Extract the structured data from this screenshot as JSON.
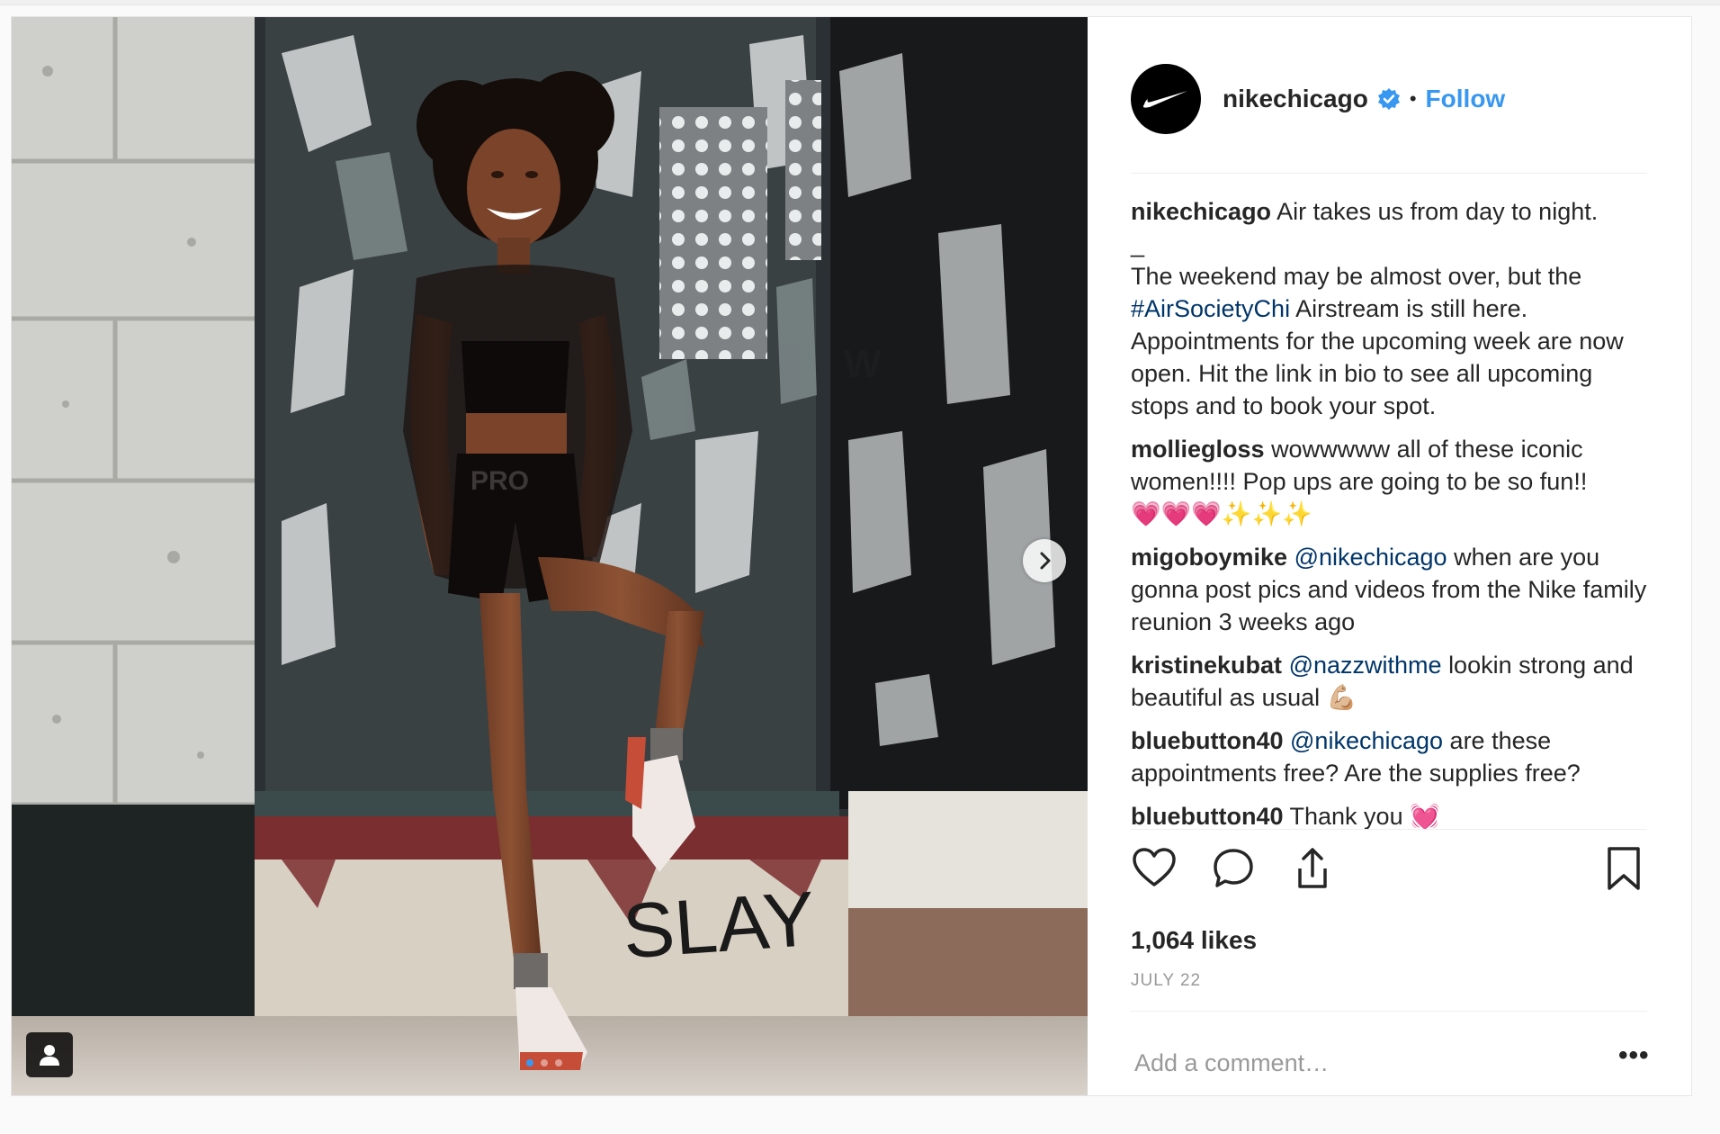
{
  "post": {
    "author": "nikechicago",
    "verified": true,
    "separator": "•",
    "follow_label": "Follow",
    "caption": {
      "user": "nikechicago",
      "line1": "Air takes us from day to night.",
      "dash": "_",
      "part1": "The weekend may be almost over, but the",
      "hashtag": "#AirSocietyChi",
      "part2": "Airstream is still here. Appointments for the upcoming week are now open. Hit the link in bio to see all upcoming stops and to book your spot."
    },
    "comments": [
      {
        "user": "molliegloss",
        "mention": "",
        "text": "wowwwww all of these iconic women!!!! Pop ups are going to be so fun!!",
        "emoji": "💗💗💗✨✨✨"
      },
      {
        "user": "migoboymike",
        "mention": "@nikechicago",
        "text": "when are you gonna post pics and videos from the Nike family reunion 3 weeks ago",
        "emoji": ""
      },
      {
        "user": "kristinekubat",
        "mention": "@nazzwithme",
        "text": "lookin strong and beautiful as usual",
        "emoji": "💪🏼"
      },
      {
        "user": "bluebutton40",
        "mention": "@nikechicago",
        "text": "are these appointments free? Are the supplies free?",
        "emoji": ""
      },
      {
        "user": "bluebutton40",
        "mention": "",
        "text": "Thank you",
        "emoji": "💓"
      }
    ],
    "likes": "1,064 likes",
    "date": "JULY 22",
    "comment_placeholder": "Add a comment…",
    "more_label": "•••",
    "photo": {
      "wall_graffiti": "SLAY",
      "shorts_text": "PRO"
    },
    "colors": {
      "link": "#003569",
      "follow": "#3897f0",
      "muted": "#999999"
    },
    "icons": [
      "heart-icon",
      "comment-icon",
      "share-icon",
      "bookmark-icon",
      "chevron-right-icon",
      "user-tag-icon",
      "nike-swoosh-icon",
      "verified-badge-icon"
    ]
  }
}
